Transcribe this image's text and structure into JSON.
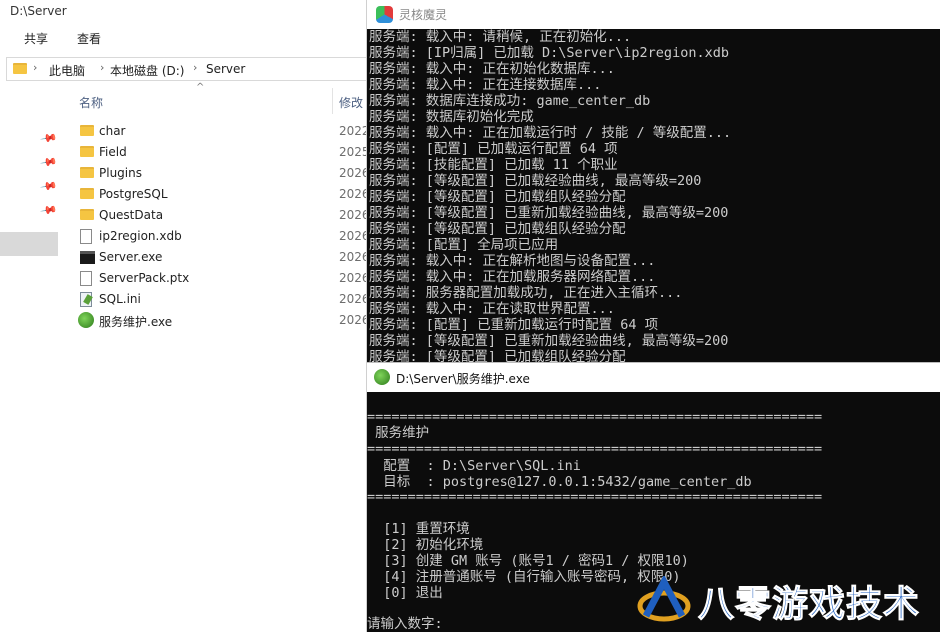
{
  "explorer": {
    "window_title": "D:\\Server",
    "ribbon": {
      "share": "共享",
      "view": "查看"
    },
    "breadcrumb": [
      "此电脑",
      "本地磁盘 (D:)",
      "Server"
    ],
    "columns": {
      "name": "名称",
      "modified": "修改"
    },
    "files": [
      {
        "name": "char",
        "type": "folder",
        "date": "2022"
      },
      {
        "name": "Field",
        "type": "folder",
        "date": "2025"
      },
      {
        "name": "Plugins",
        "type": "folder",
        "date": "2026"
      },
      {
        "name": "PostgreSQL",
        "type": "folder",
        "date": "2026"
      },
      {
        "name": "QuestData",
        "type": "folder",
        "date": "2026"
      },
      {
        "name": "ip2region.xdb",
        "type": "file",
        "date": "2026"
      },
      {
        "name": "Server.exe",
        "type": "exe",
        "date": "2026"
      },
      {
        "name": "ServerPack.ptx",
        "type": "file",
        "date": "2026"
      },
      {
        "name": "SQL.ini",
        "type": "ini",
        "date": "2026"
      },
      {
        "name": "服务维护.exe",
        "type": "green-exe",
        "date": "2026"
      }
    ]
  },
  "console1": {
    "title": "灵核魔灵",
    "lines": [
      "服务端: 载入中: 请稍候, 正在初始化...",
      "服务端: [IP归属] 已加载 D:\\Server\\ip2region.xdb",
      "服务端: 载入中: 正在初始化数据库...",
      "服务端: 载入中: 正在连接数据库...",
      "服务端: 数据库连接成功: game_center_db",
      "服务端: 数据库初始化完成",
      "服务端: 载入中: 正在加载运行时 / 技能 / 等级配置...",
      "服务端: [配置] 已加载运行配置 64 项",
      "服务端: [技能配置] 已加载 11 个职业",
      "服务端: [等级配置] 已加载经验曲线, 最高等级=200",
      "服务端: [等级配置] 已加载组队经验分配",
      "服务端: [等级配置] 已重新加载经验曲线, 最高等级=200",
      "服务端: [等级配置] 已加载组队经验分配",
      "服务端: [配置] 全局项已应用",
      "服务端: 载入中: 正在解析地图与设备配置...",
      "服务端: 载入中: 正在加载服务器网络配置...",
      "服务端: 服务器配置加载成功, 正在进入主循环...",
      "服务端: 载入中: 正在读取世界配置...",
      "服务端: [配置] 已重新加载运行时配置 64 项",
      "服务端: [等级配置] 已重新加载经验曲线, 最高等级=200",
      "服务端: [等级配置] 已加载组队经验分配"
    ]
  },
  "console2": {
    "title": "D:\\Server\\服务维护.exe",
    "rule": "========================================================",
    "heading": " 服务维护",
    "config": "  配置  : D:\\Server\\SQL.ini",
    "target": "  目标  : postgres@127.0.0.1:5432/game_center_db",
    "menu": [
      "  [1] 重置环境",
      "  [2] 初始化环境",
      "  [3] 创建 GM 账号 (账号1 / 密码1 / 权限10)",
      "  [4] 注册普通账号 (自行输入账号密码, 权限0)",
      "  [0] 退出"
    ],
    "prompt": "请输入数字:"
  },
  "watermark": {
    "text": "八零游戏技术"
  }
}
